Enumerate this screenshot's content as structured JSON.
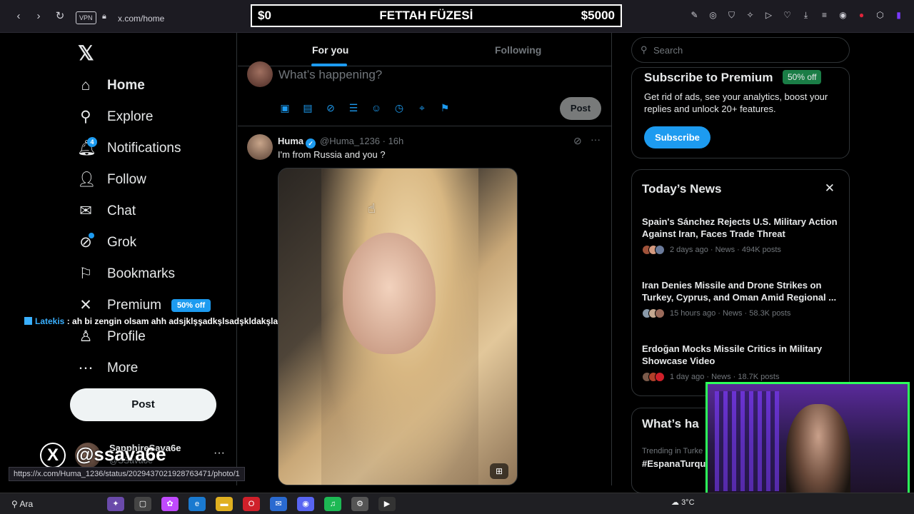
{
  "browser": {
    "vpn_label": "VPN",
    "url": "x.com/home",
    "status_url": "https://x.com/Huma_1236/status/2029437021928763471/photo/1"
  },
  "banner": {
    "left": "$0",
    "title": "FETTAH FÜZESİ",
    "right": "$5000"
  },
  "sidebar": {
    "items": [
      {
        "label": "Home",
        "icon": "home-icon"
      },
      {
        "label": "Explore",
        "icon": "search-icon"
      },
      {
        "label": "Notifications",
        "icon": "bell-icon",
        "badge": "4"
      },
      {
        "label": "Follow",
        "icon": "add-user-icon"
      },
      {
        "label": "Chat",
        "icon": "mail-icon"
      },
      {
        "label": "Grok",
        "icon": "grok-icon"
      },
      {
        "label": "Bookmarks",
        "icon": "bookmark-icon"
      },
      {
        "label": "Premium",
        "icon": "x-icon",
        "pill": "50% off"
      },
      {
        "label": "Profile",
        "icon": "person-icon"
      },
      {
        "label": "More",
        "icon": "more-icon"
      }
    ],
    "post_label": "Post",
    "account": {
      "name": "SapphireSava6e",
      "handle": "@SSava6e"
    }
  },
  "stream": {
    "chat_user": "Latekis",
    "chat_message": ": ah bi zengin olsam ahh adsjklşşadkşlsadşkldakşlads",
    "handle": "@ssava6e"
  },
  "main": {
    "tabs": [
      {
        "label": "For you"
      },
      {
        "label": "Following"
      }
    ],
    "composer": {
      "placeholder": "What’s happening?",
      "post_label": "Post"
    },
    "tweet": {
      "name": "Huma",
      "handle_time": "@Huma_1236 · 16h",
      "text": "I'm from Russia and you ?"
    }
  },
  "right": {
    "search_placeholder": "Search",
    "premium": {
      "title": "Subscribe to Premium",
      "pill": "50% off",
      "desc": "Get rid of ads, see your analytics, boost your replies and unlock 20+ features.",
      "button": "Subscribe"
    },
    "news": {
      "title": "Today’s News",
      "items": [
        {
          "headline": "Spain's Sánchez Rejects U.S. Military Action Against Iran, Faces Trade Threat",
          "meta": "2 days ago · News · 494K posts"
        },
        {
          "headline": "Iran Denies Missile and Drone Strikes on Turkey, Cyprus, and Oman Amid Regional ...",
          "meta": "15 hours ago · News · 58.3K posts"
        },
        {
          "headline": "Erdoğan Mocks Missile Critics in Military Showcase Video",
          "meta": "1 day ago · News · 18.7K posts"
        }
      ]
    },
    "whats": {
      "title": "What’s ha",
      "trend_label": "Trending in Turke",
      "trend": "#EspanaTurqu"
    }
  },
  "taskbar": {
    "search": "Ara",
    "weather": "3°C"
  }
}
